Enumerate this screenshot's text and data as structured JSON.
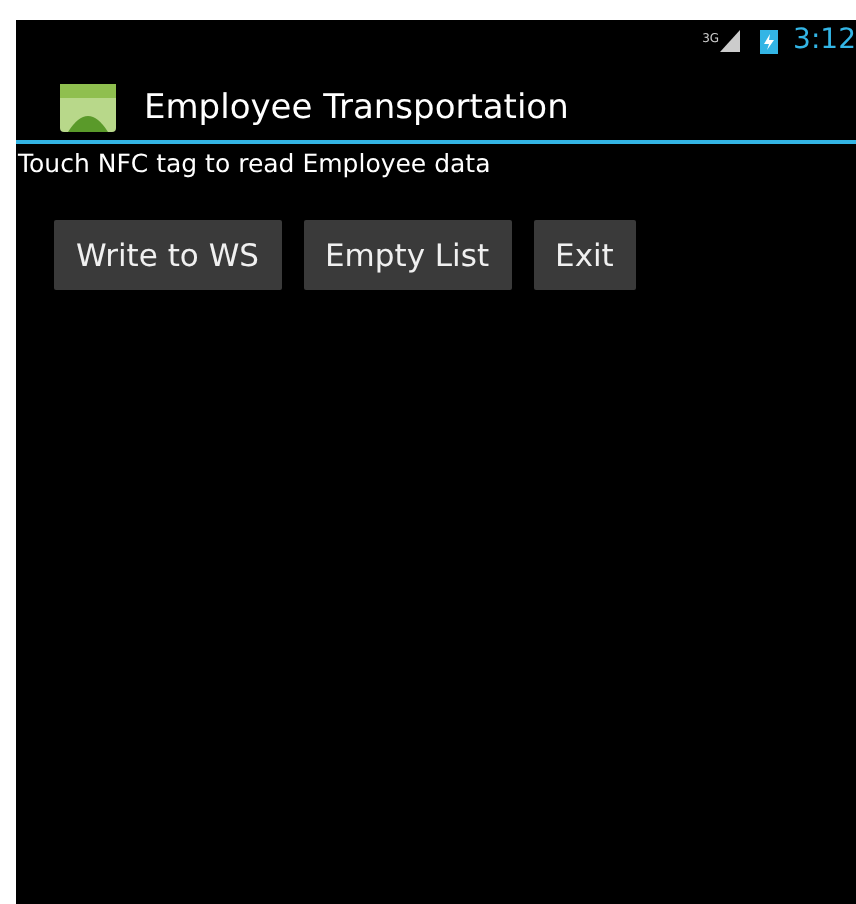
{
  "status_bar": {
    "network": "3G",
    "time": "3:12"
  },
  "action_bar": {
    "title": "Employee Transportation"
  },
  "message": "Touch NFC tag to read Employee data",
  "buttons": [
    "Write to WS",
    "Empty List",
    "Exit"
  ]
}
